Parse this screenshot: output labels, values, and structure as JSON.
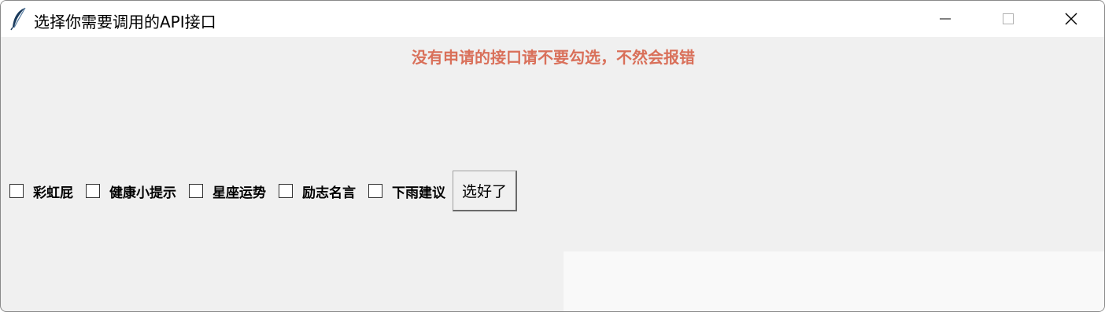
{
  "window": {
    "title": "选择你需要调用的API接口",
    "icon": "feather-icon"
  },
  "controls": {
    "minimize": "minimize-icon",
    "maximize": "maximize-icon",
    "close": "close-icon"
  },
  "warning": {
    "text": "没有申请的接口请不要勾选，不然会报错",
    "color": "#d9705a"
  },
  "options": [
    {
      "label": "彩虹屁",
      "checked": false
    },
    {
      "label": "健康小提示",
      "checked": false
    },
    {
      "label": "星座运势",
      "checked": false
    },
    {
      "label": "励志名言",
      "checked": false
    },
    {
      "label": "下雨建议",
      "checked": false
    }
  ],
  "confirm_button": {
    "label": "选好了"
  }
}
